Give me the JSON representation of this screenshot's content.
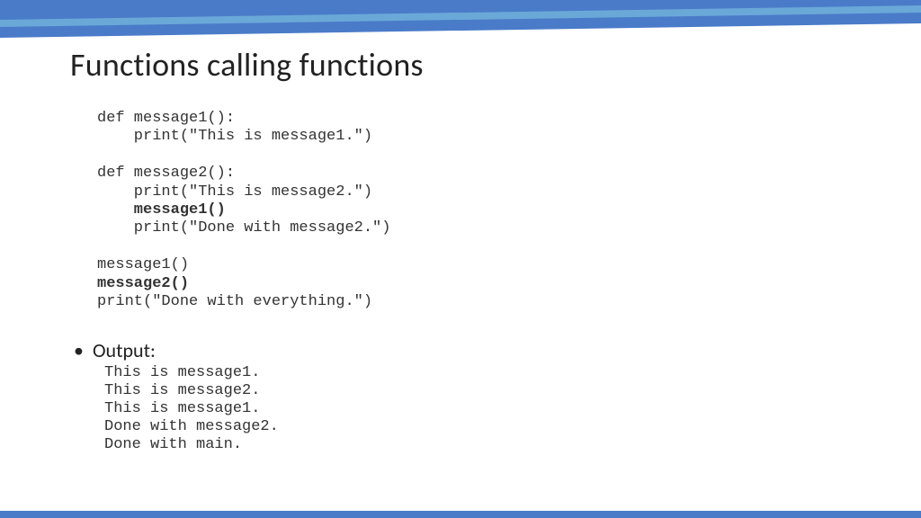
{
  "title": "Functions calling functions",
  "code": [
    {
      "text": "def message1():",
      "bold": false
    },
    {
      "text": "    print(\"This is message1.\")",
      "bold": false
    },
    {
      "text": "",
      "bold": false
    },
    {
      "text": "def message2():",
      "bold": false
    },
    {
      "text": "    print(\"This is message2.\")",
      "bold": false
    },
    {
      "text": "    message1()",
      "bold": true
    },
    {
      "text": "    print(\"Done with message2.\")",
      "bold": false
    },
    {
      "text": "",
      "bold": false
    },
    {
      "text": "message1()",
      "bold": false
    },
    {
      "text": "message2()",
      "bold": true
    },
    {
      "text": "print(\"Done with everything.\")",
      "bold": false
    }
  ],
  "output_label": "Output:",
  "output": [
    "This is message1.",
    "This is message2.",
    "This is message1.",
    "Done with message2.",
    "Done with main."
  ],
  "colors": {
    "band_dark": "#4a7bc8",
    "band_light": "#6aa8d8"
  }
}
